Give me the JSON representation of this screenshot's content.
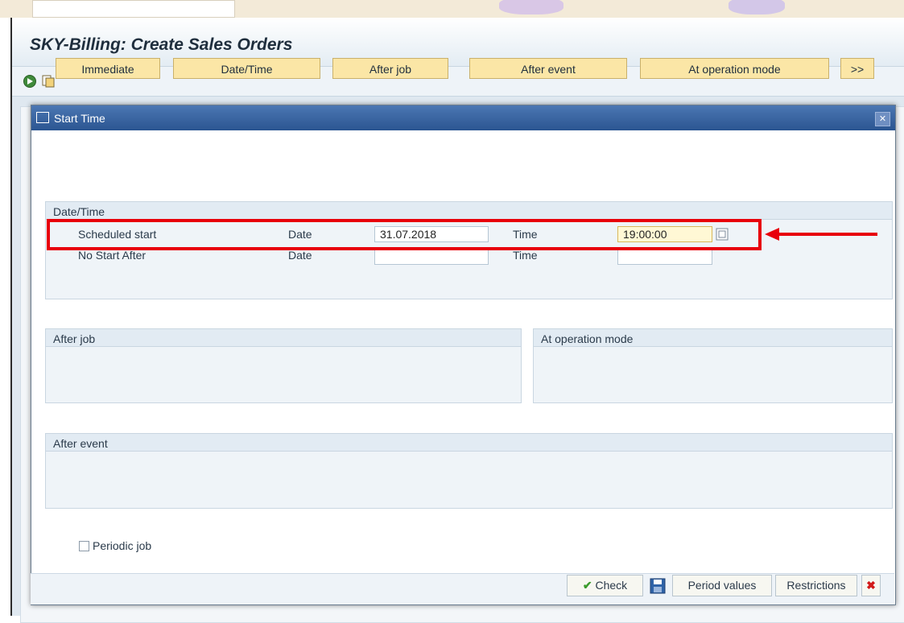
{
  "window": {
    "title": "SKY-Billing: Create Sales Orders",
    "toolbar_icons": [
      "execute-icon",
      "copy-icon"
    ]
  },
  "dialog": {
    "title": "Start Time",
    "close_icon": "close-icon",
    "buttons": {
      "immediate": "Immediate",
      "date_time": "Date/Time",
      "after_job": "After job",
      "after_event": "After event",
      "at_operation_mode": "At operation mode",
      "more": ">>"
    },
    "date_time_group": {
      "title": "Date/Time",
      "rows": [
        {
          "label": "Scheduled start",
          "date_label": "Date",
          "date_value": "31.07.2018",
          "time_label": "Time",
          "time_value": "19:00:00"
        },
        {
          "label": "No Start After",
          "date_label": "Date",
          "date_value": "",
          "time_label": "Time",
          "time_value": ""
        }
      ]
    },
    "after_job_group": {
      "title": "After job"
    },
    "at_operation_mode_group": {
      "title": "At operation mode"
    },
    "after_event_group": {
      "title": "After event"
    },
    "periodic_job": {
      "label": "Periodic job",
      "checked": false
    },
    "footer": {
      "check": "Check",
      "period_values": "Period values",
      "restrictions": "Restrictions"
    }
  },
  "annotation": {
    "highlight_color": "#e8000b"
  }
}
